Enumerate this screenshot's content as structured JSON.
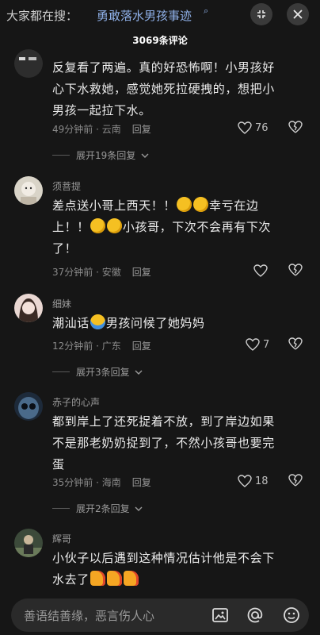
{
  "header": {
    "search_prefix": "大家都在搜：",
    "search_term": "勇敢落水男孩事迹",
    "search_glyph": "⌕"
  },
  "comment_count": "3069条评论",
  "comments": [
    {
      "username": "",
      "lines": [
        "反复看了两遍。真的好恐怖啊！小男孩好",
        "心下水救她，感觉她死拉硬拽的，想把小",
        "男孩一起拉下水。"
      ],
      "time": "49分钟前 · 云南",
      "reply": "回复",
      "likes": "76",
      "expand": "展开19条回复"
    },
    {
      "username": "须菩提",
      "line1": "差点送小哥上西天！！",
      "line1b": "幸亏在边",
      "line2a": "上！！",
      "line2b": "小孩哥，下次不会再有下次",
      "line3": "了！",
      "time": "37分钟前 · 安徽",
      "reply": "回复",
      "likes": ""
    },
    {
      "username": "细妹",
      "line1a": "潮汕话",
      "line1b": "男孩问候了她妈妈",
      "time": "12分钟前 · 广东",
      "reply": "回复",
      "likes": "7",
      "expand": "展开3条回复"
    },
    {
      "username": "赤子的心声",
      "lines": [
        "都到岸上了还死捉着不放，到了岸边如果",
        "不是那老奶奶捉到了，不然小孩哥也要完",
        "蛋"
      ],
      "time": "35分钟前 · 海南",
      "reply": "回复",
      "likes": "18",
      "expand": "展开2条回复"
    },
    {
      "username": "辉哥",
      "lines": [
        "小伙子以后遇到这种情况估计他是不会下",
        "水去了"
      ],
      "time": "",
      "reply": "",
      "likes": ""
    }
  ],
  "input": {
    "placeholder": "善语结善缘，恶言伤人心"
  },
  "icons": [
    "minimize-icon",
    "close-icon",
    "heart-icon",
    "broken-heart-icon",
    "chevron-down-icon",
    "image-icon",
    "at-icon",
    "emoji-icon"
  ]
}
